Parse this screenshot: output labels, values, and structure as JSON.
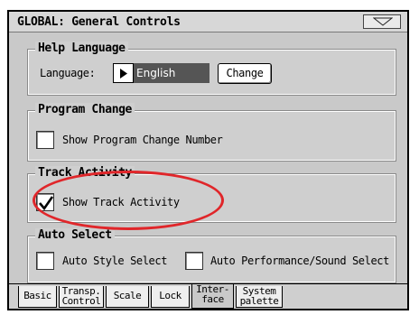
{
  "window": {
    "title": "GLOBAL: General Controls"
  },
  "help_language": {
    "title": "Help Language",
    "language_label": "Language:",
    "language_value": "English",
    "change_button": "Change"
  },
  "program_change": {
    "title": "Program Change",
    "show_number_label": "Show Program Change Number",
    "show_number_checked": false
  },
  "track_activity": {
    "title": "Track Activity",
    "show_activity_label": "Show Track Activity",
    "show_activity_checked": true
  },
  "auto_select": {
    "title": "Auto Select",
    "auto_style_label": "Auto Style Select",
    "auto_style_checked": false,
    "auto_perf_label": "Auto Performance/Sound Select",
    "auto_perf_checked": false
  },
  "tabs": [
    {
      "line1": "Basic",
      "line2": ""
    },
    {
      "line1": "Transp.",
      "line2": "Control"
    },
    {
      "line1": "Scale",
      "line2": ""
    },
    {
      "line1": "Lock",
      "line2": ""
    },
    {
      "line1": "Inter-",
      "line2": "face",
      "active": true
    },
    {
      "line1": "System",
      "line2": "palette"
    }
  ],
  "colors": {
    "highlight": "#e0262a",
    "selected_field": "#555555"
  },
  "icons": {
    "menu": "triangle-down-icon",
    "dropdown": "triangle-right-icon",
    "check": "checkmark-icon"
  }
}
